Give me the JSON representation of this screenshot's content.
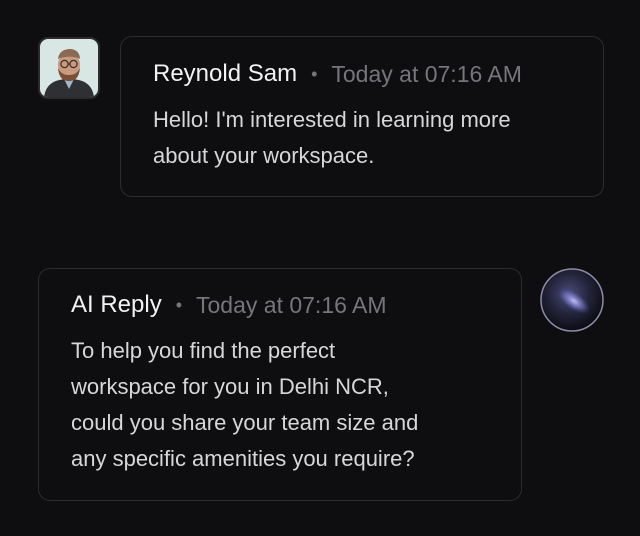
{
  "messages": [
    {
      "sender": "Reynold Sam",
      "separator": "•",
      "timestamp": "Today at 07:16 AM",
      "lines": [
        "Hello! I'm interested in learning more",
        "about your workspace."
      ]
    },
    {
      "sender": "AI Reply",
      "separator": "•",
      "timestamp": "Today at 07:16 AM",
      "lines": [
        "To help you find the perfect",
        "workspace for you in Delhi NCR,",
        "could you share your team size and",
        "any specific amenities you require?"
      ]
    }
  ]
}
